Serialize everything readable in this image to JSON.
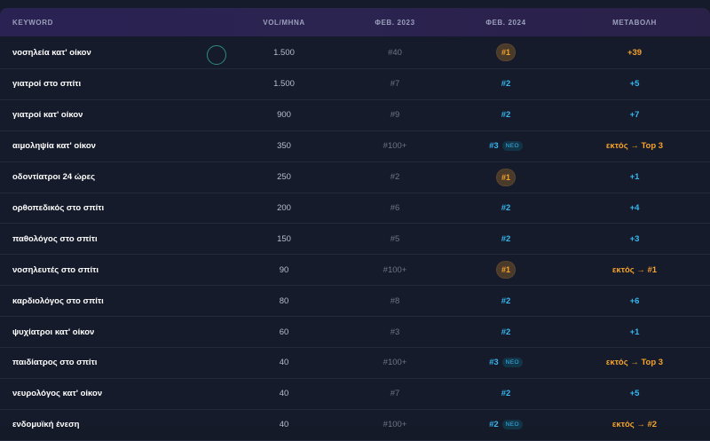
{
  "headers": {
    "keyword": "KEYWORD",
    "volume": "VOL/ΜΗΝΑ",
    "feb2023": "ΦΕΒ. 2023",
    "feb2024": "ΦΕΒ. 2024",
    "change": "ΜΕΤΑΒΟΛΗ"
  },
  "accent_colors": {
    "blue": "#36b7f0",
    "gold": "#f6a32a",
    "header_bg": "#2a2252",
    "body_bg": "#151b2a"
  },
  "rows": [
    {
      "keyword": "νοσηλεία κατ' οίκον",
      "volume": "1.500",
      "feb2023": "#40",
      "feb2024": "#1",
      "feb2024_style": "gold",
      "new": "",
      "change": "+39",
      "change_style": "gold"
    },
    {
      "keyword": "γιατροί στο σπίτι",
      "volume": "1.500",
      "feb2023": "#7",
      "feb2024": "#2",
      "feb2024_style": "blue",
      "new": "",
      "change": "+5",
      "change_style": "blue"
    },
    {
      "keyword": "γιατροί κατ' οίκον",
      "volume": "900",
      "feb2023": "#9",
      "feb2024": "#2",
      "feb2024_style": "blue",
      "new": "",
      "change": "+7",
      "change_style": "blue"
    },
    {
      "keyword": "αιμοληψία κατ' οίκον",
      "volume": "350",
      "feb2023": "#100+",
      "feb2024": "#3",
      "feb2024_style": "blue",
      "new": "ΝΕΟ",
      "change": "εκτός → Top 3",
      "change_style": "gold"
    },
    {
      "keyword": "οδοντίατροι 24 ώρες",
      "volume": "250",
      "feb2023": "#2",
      "feb2024": "#1",
      "feb2024_style": "gold",
      "new": "",
      "change": "+1",
      "change_style": "blue"
    },
    {
      "keyword": "ορθοπεδικός στο σπίτι",
      "volume": "200",
      "feb2023": "#6",
      "feb2024": "#2",
      "feb2024_style": "blue",
      "new": "",
      "change": "+4",
      "change_style": "blue"
    },
    {
      "keyword": "παθολόγος στο σπίτι",
      "volume": "150",
      "feb2023": "#5",
      "feb2024": "#2",
      "feb2024_style": "blue",
      "new": "",
      "change": "+3",
      "change_style": "blue"
    },
    {
      "keyword": "νοσηλευτές στο σπίτι",
      "volume": "90",
      "feb2023": "#100+",
      "feb2024": "#1",
      "feb2024_style": "gold",
      "new": "",
      "change": "εκτός → #1",
      "change_style": "gold"
    },
    {
      "keyword": "καρδιολόγος στο σπίτι",
      "volume": "80",
      "feb2023": "#8",
      "feb2024": "#2",
      "feb2024_style": "blue",
      "new": "",
      "change": "+6",
      "change_style": "blue"
    },
    {
      "keyword": "ψυχίατροι κατ' οίκον",
      "volume": "60",
      "feb2023": "#3",
      "feb2024": "#2",
      "feb2024_style": "blue",
      "new": "",
      "change": "+1",
      "change_style": "blue"
    },
    {
      "keyword": "παιδίατρος στο σπίτι",
      "volume": "40",
      "feb2023": "#100+",
      "feb2024": "#3",
      "feb2024_style": "blue",
      "new": "ΝΕΟ",
      "change": "εκτός → Top 3",
      "change_style": "gold"
    },
    {
      "keyword": "νευρολόγος κατ' οίκον",
      "volume": "40",
      "feb2023": "#7",
      "feb2024": "#2",
      "feb2024_style": "blue",
      "new": "",
      "change": "+5",
      "change_style": "blue"
    },
    {
      "keyword": "ενδομυϊκή ένεση",
      "volume": "40",
      "feb2023": "#100+",
      "feb2024": "#2",
      "feb2024_style": "blue",
      "new": "ΝΕΟ",
      "change": "εκτός → #2",
      "change_style": "gold"
    }
  ]
}
